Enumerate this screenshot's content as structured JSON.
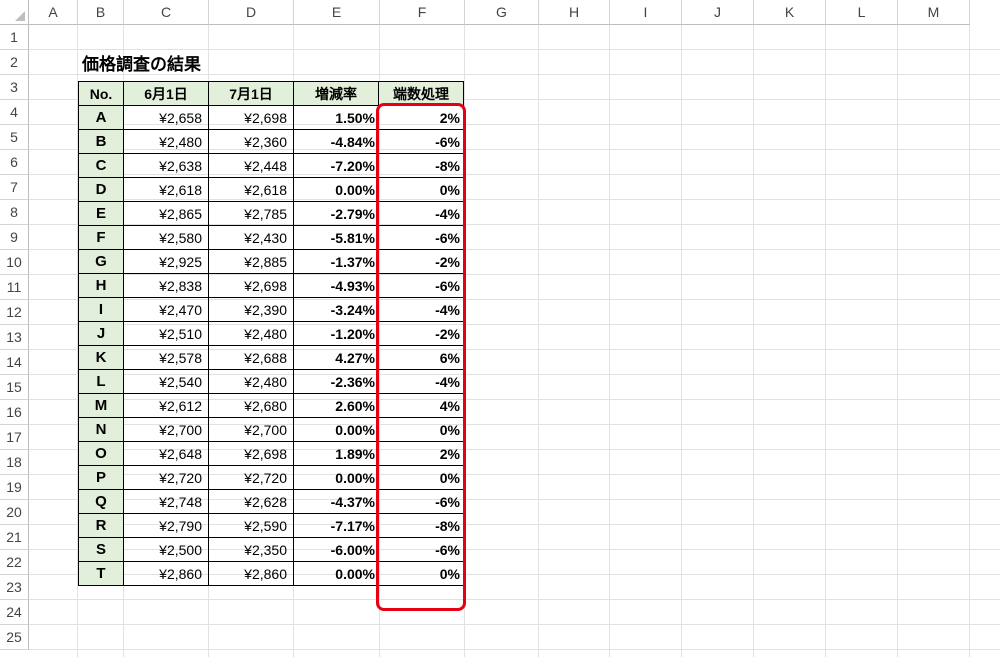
{
  "columns": [
    "A",
    "B",
    "C",
    "D",
    "E",
    "F",
    "G",
    "H",
    "I",
    "J",
    "K",
    "L",
    "M"
  ],
  "rows": [
    "1",
    "2",
    "3",
    "4",
    "5",
    "6",
    "7",
    "8",
    "9",
    "10",
    "11",
    "12",
    "13",
    "14",
    "15",
    "16",
    "17",
    "18",
    "19",
    "20",
    "21",
    "22",
    "23",
    "24",
    "25"
  ],
  "title": "価格調査の結果",
  "table": {
    "headers": [
      "No.",
      "6月1日",
      "7月1日",
      "増減率",
      "端数処理"
    ],
    "rows": [
      [
        "A",
        "¥2,658",
        "¥2,698",
        "1.50%",
        "2%"
      ],
      [
        "B",
        "¥2,480",
        "¥2,360",
        "-4.84%",
        "-6%"
      ],
      [
        "C",
        "¥2,638",
        "¥2,448",
        "-7.20%",
        "-8%"
      ],
      [
        "D",
        "¥2,618",
        "¥2,618",
        "0.00%",
        "0%"
      ],
      [
        "E",
        "¥2,865",
        "¥2,785",
        "-2.79%",
        "-4%"
      ],
      [
        "F",
        "¥2,580",
        "¥2,430",
        "-5.81%",
        "-6%"
      ],
      [
        "G",
        "¥2,925",
        "¥2,885",
        "-1.37%",
        "-2%"
      ],
      [
        "H",
        "¥2,838",
        "¥2,698",
        "-4.93%",
        "-6%"
      ],
      [
        "I",
        "¥2,470",
        "¥2,390",
        "-3.24%",
        "-4%"
      ],
      [
        "J",
        "¥2,510",
        "¥2,480",
        "-1.20%",
        "-2%"
      ],
      [
        "K",
        "¥2,578",
        "¥2,688",
        "4.27%",
        "6%"
      ],
      [
        "L",
        "¥2,540",
        "¥2,480",
        "-2.36%",
        "-4%"
      ],
      [
        "M",
        "¥2,612",
        "¥2,680",
        "2.60%",
        "4%"
      ],
      [
        "N",
        "¥2,700",
        "¥2,700",
        "0.00%",
        "0%"
      ],
      [
        "O",
        "¥2,648",
        "¥2,698",
        "1.89%",
        "2%"
      ],
      [
        "P",
        "¥2,720",
        "¥2,720",
        "0.00%",
        "0%"
      ],
      [
        "Q",
        "¥2,748",
        "¥2,628",
        "-4.37%",
        "-6%"
      ],
      [
        "R",
        "¥2,790",
        "¥2,590",
        "-7.17%",
        "-8%"
      ],
      [
        "S",
        "¥2,500",
        "¥2,350",
        "-6.00%",
        "-6%"
      ],
      [
        "T",
        "¥2,860",
        "¥2,860",
        "0.00%",
        "0%"
      ]
    ]
  },
  "highlight_color": "#e60012",
  "header_fill": "#e2efda"
}
